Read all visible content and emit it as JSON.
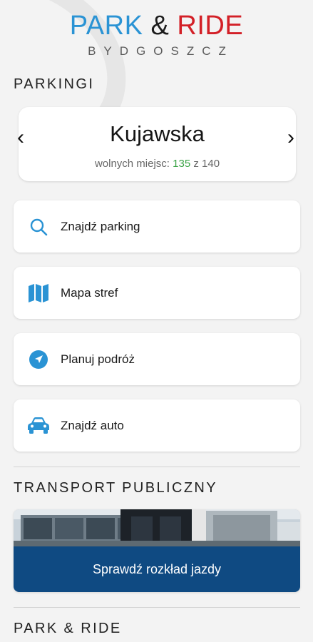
{
  "logo": {
    "park": "PARK",
    "amp": "&",
    "ride": "RIDE",
    "city": "BYDGOSZCZ",
    "colors": {
      "park": "#2a93d4",
      "ride": "#d32027"
    }
  },
  "parkings": {
    "title": "PARKINGI",
    "current": {
      "name": "Kujawska",
      "free_label": "wolnych miejsc:",
      "free": "135",
      "separator": "z",
      "total": "140"
    },
    "prev_icon": "chevron-left-icon",
    "next_icon": "chevron-right-icon"
  },
  "menu": [
    {
      "label": "Znajdź parking",
      "icon": "search-icon"
    },
    {
      "label": "Mapa stref",
      "icon": "map-icon"
    },
    {
      "label": "Planuj podróż",
      "icon": "navigation-icon"
    },
    {
      "label": "Znajdź auto",
      "icon": "car-icon"
    }
  ],
  "accent_color": "#2a93d4",
  "transport": {
    "title": "TRANSPORT PUBLICZNY",
    "button_label": "Sprawdź rozkład jazdy",
    "button_color": "#0f4a82"
  },
  "park_ride": {
    "title": "PARK & RIDE"
  }
}
